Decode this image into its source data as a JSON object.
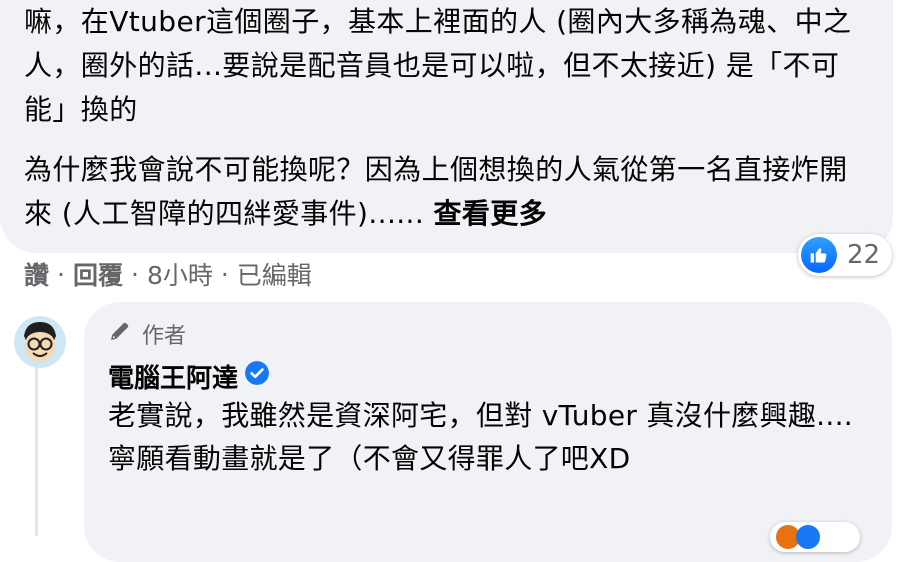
{
  "original_comment": {
    "paragraph1": "嘛，在Vtuber這個圈子，基本上裡面的人 (圈內大多稱為魂、中之人，圈外的話...要說是配音員也是可以啦，但不太接近) 是「不可能」換的",
    "paragraph2": "為什麼我會說不可能換呢？因為上個想換的人氣從第一名直接炸開來 (人工智障的四絆愛事件)......",
    "see_more": "查看更多",
    "reaction_count": "22",
    "reaction_icon": "like-icon",
    "actions": {
      "like": "讚",
      "reply": "回覆",
      "time": "8小時",
      "edited": "已編輯"
    }
  },
  "reply": {
    "author_badge": "作者",
    "author_badge_icon": "pen-icon",
    "author_name": "電腦王阿達",
    "verified_icon": "verified-check-icon",
    "lines": [
      "老實說，我雖然是資深阿宅，但對 vTuber 真沒什麼興趣....",
      "寧願看動畫就是了（不會又得罪人了吧XD"
    ]
  },
  "colors": {
    "bubble_bg": "#f0f2f5",
    "secondary_text": "#65676b",
    "like_blue": "#1877f2"
  }
}
